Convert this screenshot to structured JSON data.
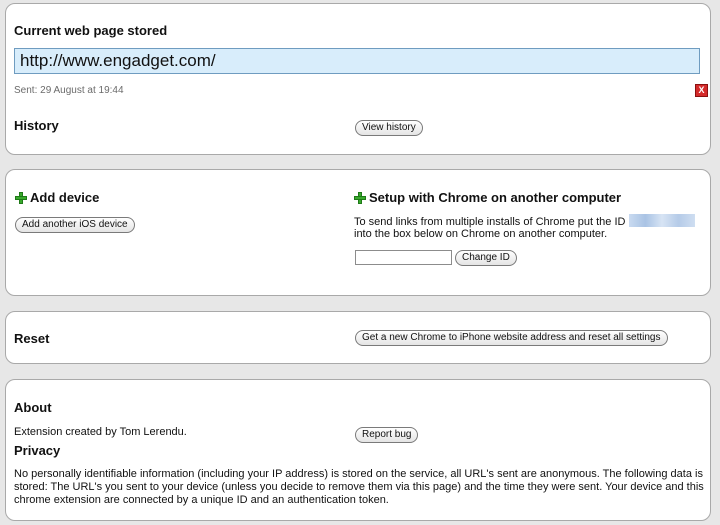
{
  "current_page": {
    "heading": "Current web page stored",
    "url": "http://www.engadget.com/",
    "sent_text": "Sent: 29 August at 19:44",
    "remove_label": "X"
  },
  "history": {
    "heading": "History",
    "button_label": "View history"
  },
  "add_device": {
    "heading": "Add device",
    "button_label": "Add another iOS device"
  },
  "setup": {
    "heading": "Setup with Chrome on another computer",
    "instruction_before_id": "To send links from multiple installs of Chrome put the ID",
    "instruction_after_id": "into the box below on Chrome on another computer.",
    "id_input_value": "",
    "change_id_label": "Change ID"
  },
  "reset": {
    "heading": "Reset",
    "button_label": "Get a new Chrome to iPhone website address and reset all settings"
  },
  "about": {
    "heading": "About",
    "credit": "Extension created by Tom Lerendu.",
    "report_bug_label": "Report bug"
  },
  "privacy": {
    "heading": "Privacy",
    "text": "No personally identifiable information (including your IP address) is stored on the service, all URL's sent are anonymous. The following data is stored: The URL's you sent to your device (unless you decide to remove them via this page) and the time they were sent. Your device and this chrome extension are connected by a unique ID and an authentication token."
  },
  "colors": {
    "background": "#e7e7e7",
    "panel": "#ffffff",
    "url_field": "#d8edfb",
    "plus_icon": "#39a92c",
    "remove_button": "#d42a2a"
  },
  "icons": {
    "add_device": "plus-icon",
    "setup": "plus-icon",
    "remove": "close-icon"
  }
}
